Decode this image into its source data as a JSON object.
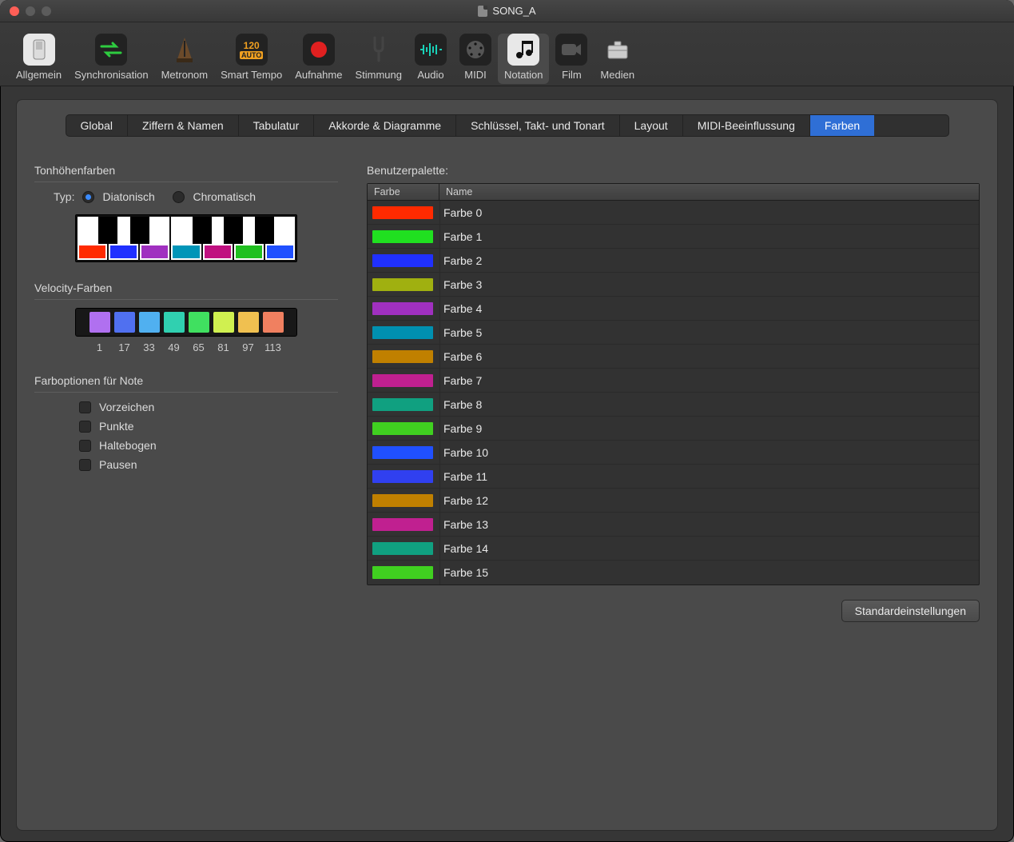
{
  "window": {
    "title": "SONG_A"
  },
  "toolbar": {
    "items": [
      {
        "label": "Allgemein"
      },
      {
        "label": "Synchronisation"
      },
      {
        "label": "Metronom"
      },
      {
        "label": "Smart Tempo"
      },
      {
        "label": "Aufnahme"
      },
      {
        "label": "Stimmung"
      },
      {
        "label": "Audio"
      },
      {
        "label": "MIDI"
      },
      {
        "label": "Notation"
      },
      {
        "label": "Film"
      },
      {
        "label": "Medien"
      }
    ],
    "activeIndex": 8
  },
  "tabs": {
    "items": [
      {
        "label": "Global"
      },
      {
        "label": "Ziffern & Namen"
      },
      {
        "label": "Tabulatur"
      },
      {
        "label": "Akkorde & Diagramme"
      },
      {
        "label": "Schlüssel, Takt- und Tonart"
      },
      {
        "label": "Layout"
      },
      {
        "label": "MIDI-Beeinflussung"
      },
      {
        "label": "Farben"
      }
    ],
    "activeIndex": 7
  },
  "pitchColors": {
    "title": "Tonhöhenfarben",
    "typeLabel": "Typ:",
    "options": {
      "diatonic": "Diatonisch",
      "chromatic": "Chromatisch"
    },
    "selected": "diatonic",
    "whiteKeySwatches": [
      "#ff2a00",
      "#2030ff",
      "#a030c0",
      "#0095b8",
      "#c01080",
      "#20c020",
      "#2050ff"
    ]
  },
  "velocityColors": {
    "title": "Velocity-Farben",
    "swatches": [
      "#b070f0",
      "#5070f0",
      "#50b0f0",
      "#30d0b0",
      "#40e060",
      "#d0f050",
      "#f0c050",
      "#f08060"
    ],
    "numbers": [
      "1",
      "17",
      "33",
      "49",
      "65",
      "81",
      "97",
      "113"
    ]
  },
  "noteOptions": {
    "title": "Farboptionen für Note",
    "items": [
      {
        "label": "Vorzeichen",
        "checked": false
      },
      {
        "label": "Punkte",
        "checked": false
      },
      {
        "label": "Haltebogen",
        "checked": false
      },
      {
        "label": "Pausen",
        "checked": false
      }
    ]
  },
  "palette": {
    "title": "Benutzerpalette:",
    "headers": {
      "color": "Farbe",
      "name": "Name"
    },
    "rows": [
      {
        "color": "#ff2a00",
        "name": "Farbe 0"
      },
      {
        "color": "#20e020",
        "name": "Farbe 1"
      },
      {
        "color": "#2030ff",
        "name": "Farbe 2"
      },
      {
        "color": "#a0b010",
        "name": "Farbe 3"
      },
      {
        "color": "#a030c0",
        "name": "Farbe 4"
      },
      {
        "color": "#0090b0",
        "name": "Farbe 5"
      },
      {
        "color": "#c08000",
        "name": "Farbe 6"
      },
      {
        "color": "#c02090",
        "name": "Farbe 7"
      },
      {
        "color": "#10a080",
        "name": "Farbe 8"
      },
      {
        "color": "#40d020",
        "name": "Farbe 9"
      },
      {
        "color": "#2050ff",
        "name": "Farbe 10"
      },
      {
        "color": "#3040f0",
        "name": "Farbe 11"
      },
      {
        "color": "#c08000",
        "name": "Farbe 12"
      },
      {
        "color": "#c02090",
        "name": "Farbe 13"
      },
      {
        "color": "#10a080",
        "name": "Farbe 14"
      },
      {
        "color": "#40d020",
        "name": "Farbe 15"
      }
    ]
  },
  "buttons": {
    "defaults": "Standardeinstellungen"
  }
}
